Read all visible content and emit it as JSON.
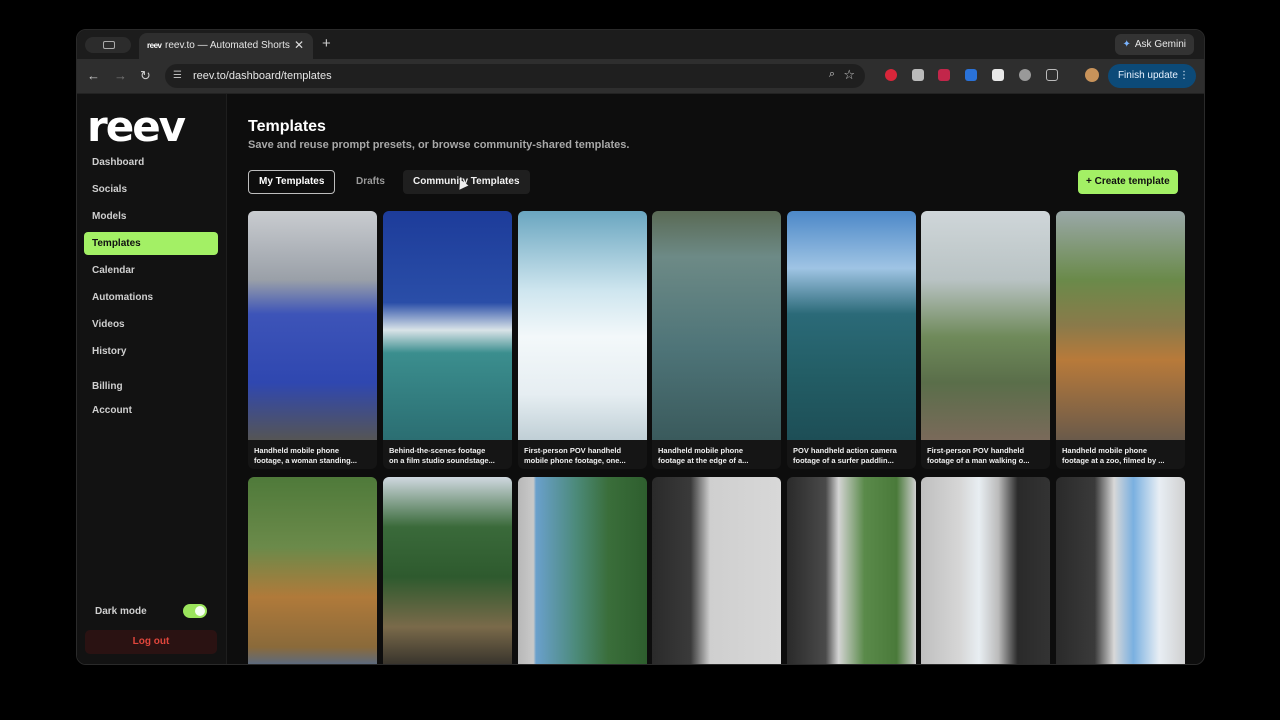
{
  "browser": {
    "tab_title": "reev.to — Automated Shorts",
    "tab_favicon": "reev",
    "new_tab": "+",
    "close": "✕",
    "ask_gemini": "Ask Gemini",
    "url": "reev.to/dashboard/templates",
    "finish_update": "Finish update"
  },
  "sidebar": {
    "logo": "reev",
    "items": [
      {
        "label": "Dashboard"
      },
      {
        "label": "Socials"
      },
      {
        "label": "Models"
      },
      {
        "label": "Templates"
      },
      {
        "label": "Calendar"
      },
      {
        "label": "Automations"
      },
      {
        "label": "Videos"
      },
      {
        "label": "History"
      },
      {
        "label": "Billing"
      },
      {
        "label": "Account"
      }
    ],
    "dark_mode": "Dark mode",
    "logout": "Log out"
  },
  "main": {
    "title": "Templates",
    "subtitle": "Save and reuse prompt presets, or browse community-shared templates.",
    "tabs": [
      {
        "label": "My Templates"
      },
      {
        "label": "Drafts"
      },
      {
        "label": "Community Templates"
      }
    ],
    "create_button": "+ Create template"
  },
  "templates_row1": [
    {
      "line1": "Handheld mobile phone",
      "line2": "footage, a woman standing..."
    },
    {
      "line1": "Behind-the-scenes footage",
      "line2": "on a film studio soundstage..."
    },
    {
      "line1": "First-person POV handheld",
      "line2": "mobile phone footage, one..."
    },
    {
      "line1": "Handheld mobile phone",
      "line2": "footage at the edge of a..."
    },
    {
      "line1": "POV handheld action camera",
      "line2": "footage of a surfer paddlin..."
    },
    {
      "line1": "First-person POV handheld",
      "line2": "footage of a man walking o..."
    },
    {
      "line1": "Handheld mobile phone",
      "line2": "footage at a zoo, filmed by ..."
    }
  ]
}
